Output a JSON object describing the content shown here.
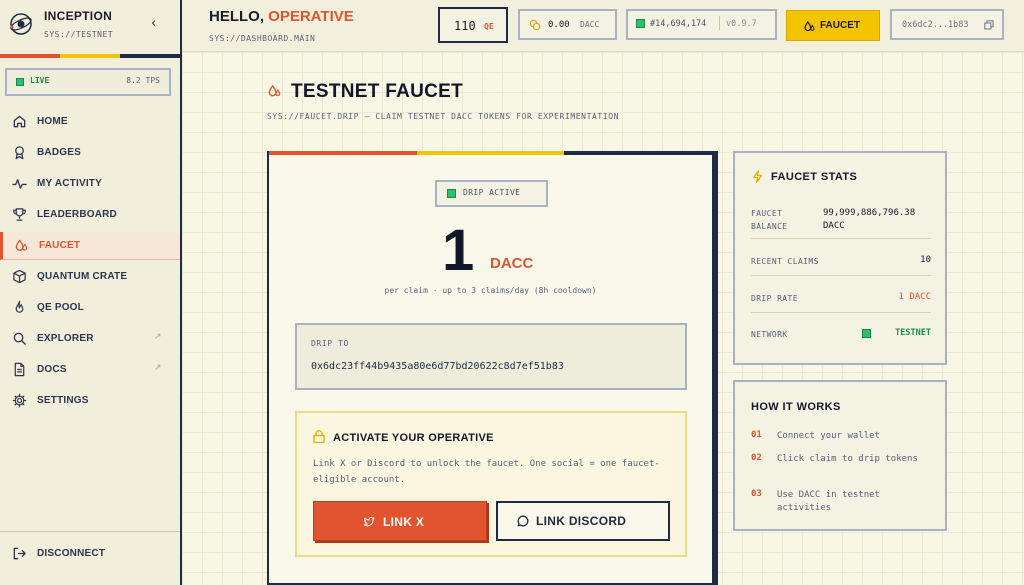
{
  "brand": {
    "name": "INCEPTION",
    "subtitle": "SYS://TESTNET",
    "stripe_colors": [
      "#e0542f",
      "#f5c400",
      "#1f2a44"
    ]
  },
  "status": {
    "label": "LIVE",
    "tps": "8.2 TPS"
  },
  "sidebar": {
    "items": [
      {
        "label": "HOME",
        "icon": "home-icon"
      },
      {
        "label": "BADGES",
        "icon": "badge-icon"
      },
      {
        "label": "MY ACTIVITY",
        "icon": "activity-icon"
      },
      {
        "label": "LEADERBOARD",
        "icon": "trophy-icon"
      },
      {
        "label": "FAUCET",
        "icon": "droplet-icon",
        "active": true
      },
      {
        "label": "QUANTUM CRATE",
        "icon": "cube-icon"
      },
      {
        "label": "QE POOL",
        "icon": "flame-icon"
      },
      {
        "label": "EXPLORER",
        "icon": "search-icon",
        "external": "↗"
      },
      {
        "label": "DOCS",
        "icon": "document-icon",
        "external": "↗"
      },
      {
        "label": "SETTINGS",
        "icon": "gear-icon"
      }
    ],
    "disconnect": "DISCONNECT"
  },
  "header": {
    "greeting": "HELLO,",
    "greeting_accent": "OPERATIVE",
    "path": "SYS://DASHBOARD.MAIN",
    "qe": {
      "value": "110",
      "unit": "QE"
    },
    "dacc": {
      "value": "0.00",
      "unit": "DACC"
    },
    "block": {
      "number": "#14,694,174",
      "version": "v0.9.7"
    },
    "faucet_button": "FAUCET",
    "wallet": "0x6dc2...1b83"
  },
  "main": {
    "title": "TESTNET FAUCET",
    "subtitle": "SYS://FAUCET.DRIP — CLAIM TESTNET DACC TOKENS FOR EXPERIMENTATION",
    "badge": "DRIP ACTIVE",
    "amount": "1",
    "amount_unit": "DACC",
    "per_claim": "per claim · up to 3 claims/day (8h cooldown)",
    "drip_to_label": "DRIP TO",
    "drip_to_address": "0x6dc23ff44b9435a80e6d77bd20622c8d7ef51b83",
    "activate": {
      "title": "ACTIVATE YOUR OPERATIVE",
      "description": "Link X or Discord to unlock the faucet. One social = one faucet-eligible account.",
      "link_x": "LINK X",
      "link_discord": "LINK DISCORD"
    }
  },
  "stats": {
    "title": "FAUCET STATS",
    "rows": [
      {
        "key": "FAUCET BALANCE",
        "value": "99,999,886,796.38 DACC"
      },
      {
        "key": "RECENT CLAIMS",
        "value": "10"
      },
      {
        "key": "DRIP RATE",
        "value": "1 DACC"
      },
      {
        "key": "NETWORK",
        "value": "TESTNET"
      }
    ]
  },
  "howto": {
    "title": "HOW IT WORKS",
    "steps": [
      {
        "n": "01",
        "text": "Connect your wallet"
      },
      {
        "n": "02",
        "text": "Click claim to drip tokens"
      },
      {
        "n": "03",
        "text": "Use DACC in testnet activities"
      }
    ]
  },
  "colors": {
    "accent": "#e0542f",
    "brand_yellow": "#f5c400",
    "navy": "#1f2a44",
    "live_green": "#2fbf6e"
  }
}
